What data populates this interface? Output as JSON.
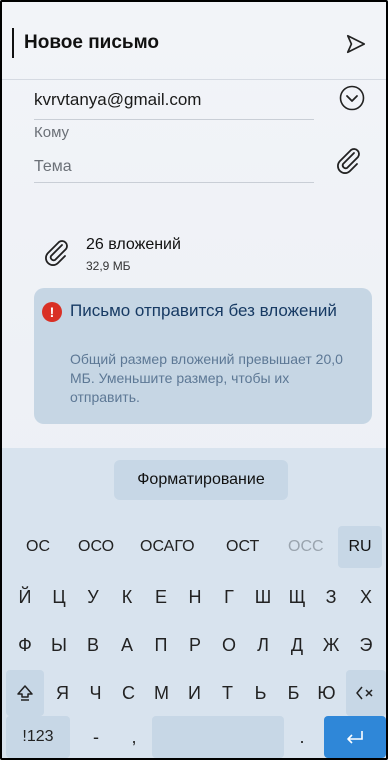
{
  "header": {
    "title": "Новое письмо",
    "send_icon": "send-icon"
  },
  "fields": {
    "from": "kvrvtanya@gmail.com",
    "to_label": "Кому",
    "subject_label": "Тема"
  },
  "attachments": {
    "count_label": "26 вложений",
    "size_label": "32,9 МБ"
  },
  "warning": {
    "title": "Письмо отправится без вложений",
    "body": "Общий размер вложений превышает 20,0 МБ. Уменьшите размер, чтобы их отправить.",
    "icon": "!",
    "color": "#d93025"
  },
  "keyboard": {
    "format_label": "Форматирование",
    "suggestions": [
      "ОС",
      "ОСО",
      "ОСАГО",
      "ОСТ",
      "ОСС"
    ],
    "lang": "RU",
    "row1": [
      "Й",
      "Ц",
      "У",
      "К",
      "Е",
      "Н",
      "Г",
      "Ш",
      "Щ",
      "З",
      "Х"
    ],
    "row2": [
      "Ф",
      "Ы",
      "В",
      "А",
      "П",
      "Р",
      "О",
      "Л",
      "Д",
      "Ж",
      "Э"
    ],
    "row3": [
      "Я",
      "Ч",
      "С",
      "М",
      "И",
      "Т",
      "Ь",
      "Б",
      "Ю"
    ],
    "shift_icon": "shift-icon",
    "backspace_icon": "backspace-icon",
    "num_label": "!123",
    "dash": "-",
    "comma": ",",
    "period": ".",
    "enter_icon": "enter-icon",
    "accent": "#2f87d8"
  }
}
